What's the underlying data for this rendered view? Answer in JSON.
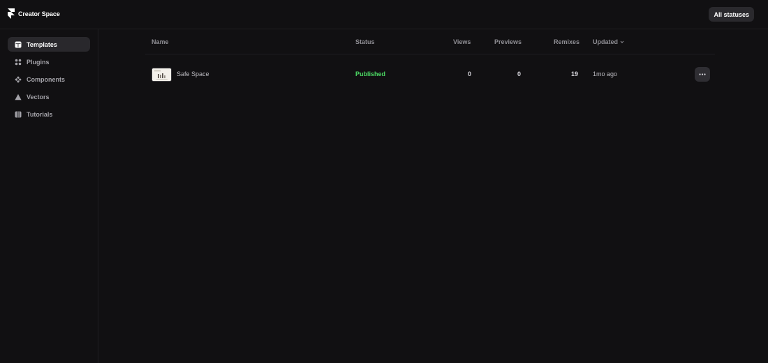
{
  "header": {
    "brand": "Creator Space",
    "status_filter": "All statuses"
  },
  "sidebar": {
    "items": [
      {
        "label": "Templates",
        "icon": "template-icon",
        "active": true
      },
      {
        "label": "Plugins",
        "icon": "plugin-icon",
        "active": false
      },
      {
        "label": "Components",
        "icon": "component-icon",
        "active": false
      },
      {
        "label": "Vectors",
        "icon": "vector-icon",
        "active": false
      },
      {
        "label": "Tutorials",
        "icon": "tutorial-icon",
        "active": false
      }
    ]
  },
  "table": {
    "columns": {
      "name": "Name",
      "status": "Status",
      "views": "Views",
      "previews": "Previews",
      "remixes": "Remixes",
      "updated": "Updated"
    },
    "rows": [
      {
        "name": "Safe Space",
        "status": "Published",
        "views": "0",
        "previews": "0",
        "remixes": "19",
        "updated": "1mo ago"
      }
    ]
  },
  "colors": {
    "background": "#111012",
    "published": "#4cd964",
    "active_nav": "#29282c",
    "button": "#2a292d"
  }
}
